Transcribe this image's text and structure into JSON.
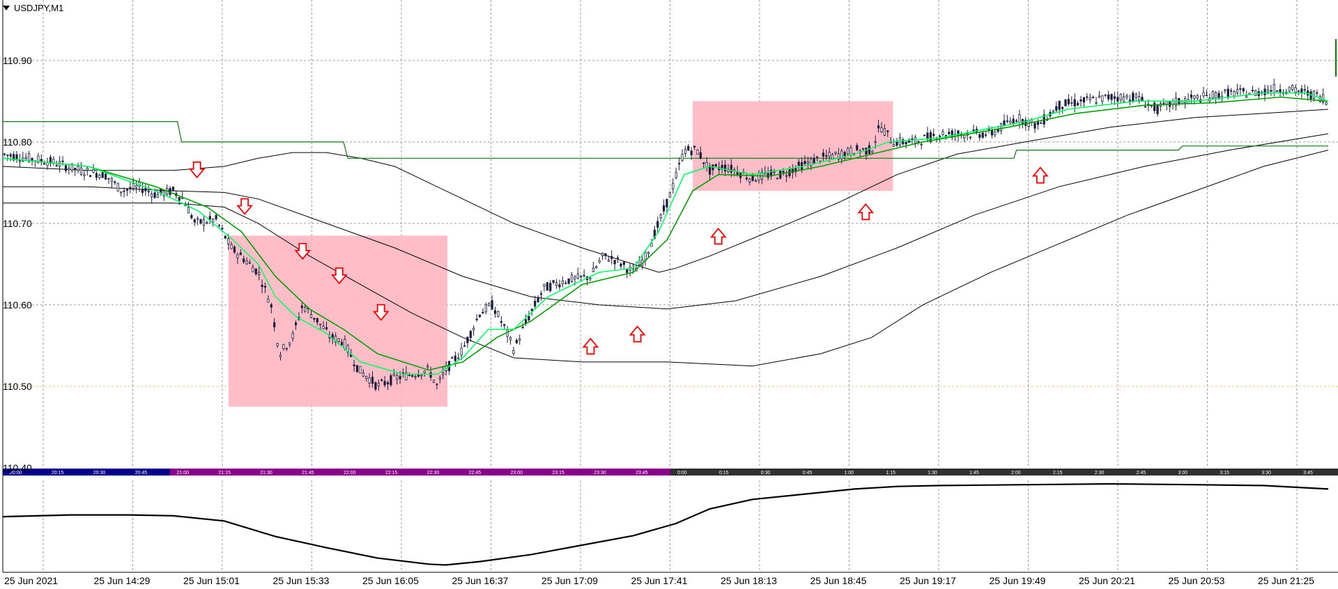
{
  "chart_window": {
    "title": "USDJPY,M1",
    "menu_icon": "triangle-down-icon"
  },
  "colors": {
    "candle": "#1a1a3e",
    "ema_fast": "#00ff66",
    "ema_slow": "#00a000",
    "ma": "#000000",
    "level": "#0a7a0a",
    "zone": "#ffb6c1",
    "arrow": "#ff0000",
    "grid": "#9a9a9a",
    "price_line": "#f0c060",
    "session_asia": "#8b008b",
    "session_ny": "#00008b",
    "session_other": "#303030"
  },
  "y_axis_labels": [
    "110.90",
    "110.80",
    "110.70",
    "110.60",
    "110.50",
    "110.40"
  ],
  "x_axis_labels": [
    "25 Jun 2021",
    "25 Jun 14:29",
    "25 Jun 15:01",
    "25 Jun 15:33",
    "25 Jun 16:05",
    "25 Jun 16:37",
    "25 Jun 17:09",
    "25 Jun 17:41",
    "25 Jun 18:13",
    "25 Jun 18:45",
    "25 Jun 19:17",
    "25 Jun 19:49",
    "25 Jun 20:21",
    "25 Jun 20:53",
    "25 Jun 21:25"
  ],
  "session_strip": {
    "labels": [
      "20:00",
      "20:15",
      "20:30",
      "20:45",
      "21:00",
      "21:15",
      "21:30",
      "21:45",
      "22:00",
      "22:15",
      "22:30",
      "22:45",
      "23:00",
      "23:15",
      "23:30",
      "23:45",
      "0:00",
      "0:15",
      "0:30",
      "0:45",
      "1:00",
      "1:15",
      "1:30",
      "1:45",
      "2:00",
      "2:15",
      "2:30",
      "2:45",
      "3:00",
      "3:15",
      "3:30",
      "3:45"
    ]
  },
  "chart_data": {
    "type": "candlestick",
    "symbol": "USDJPY",
    "timeframe": "M1",
    "ylim": [
      110.4,
      110.94
    ],
    "grid": true,
    "current_price_line": 110.5,
    "price_path": [
      [
        0,
        110.785
      ],
      [
        30,
        110.78
      ],
      [
        60,
        110.775
      ],
      [
        90,
        110.765
      ],
      [
        120,
        110.76
      ],
      [
        140,
        110.74
      ],
      [
        160,
        110.745
      ],
      [
        180,
        110.735
      ],
      [
        200,
        110.74
      ],
      [
        212,
        110.73
      ],
      [
        226,
        110.7
      ],
      [
        250,
        110.705
      ],
      [
        268,
        110.67
      ],
      [
        285,
        110.655
      ],
      [
        300,
        110.64
      ],
      [
        315,
        110.6
      ],
      [
        325,
        110.54
      ],
      [
        340,
        110.56
      ],
      [
        352,
        110.6
      ],
      [
        370,
        110.58
      ],
      [
        385,
        110.56
      ],
      [
        400,
        110.555
      ],
      [
        418,
        110.52
      ],
      [
        430,
        110.51
      ],
      [
        440,
        110.5
      ],
      [
        460,
        110.51
      ],
      [
        480,
        110.515
      ],
      [
        500,
        110.52
      ],
      [
        510,
        110.5
      ],
      [
        520,
        110.52
      ],
      [
        540,
        110.545
      ],
      [
        560,
        110.59
      ],
      [
        575,
        110.6
      ],
      [
        590,
        110.57
      ],
      [
        600,
        110.545
      ],
      [
        615,
        110.58
      ],
      [
        635,
        110.62
      ],
      [
        660,
        110.63
      ],
      [
        690,
        110.635
      ],
      [
        705,
        110.66
      ],
      [
        720,
        110.655
      ],
      [
        740,
        110.64
      ],
      [
        755,
        110.66
      ],
      [
        770,
        110.7
      ],
      [
        785,
        110.74
      ],
      [
        800,
        110.79
      ],
      [
        815,
        110.79
      ],
      [
        830,
        110.765
      ],
      [
        845,
        110.77
      ],
      [
        860,
        110.765
      ],
      [
        880,
        110.755
      ],
      [
        900,
        110.76
      ],
      [
        915,
        110.76
      ],
      [
        935,
        110.77
      ],
      [
        960,
        110.78
      ],
      [
        985,
        110.785
      ],
      [
        1000,
        110.79
      ],
      [
        1020,
        110.79
      ],
      [
        1030,
        110.82
      ],
      [
        1045,
        110.8
      ],
      [
        1070,
        110.8
      ],
      [
        1100,
        110.81
      ],
      [
        1130,
        110.81
      ],
      [
        1160,
        110.81
      ],
      [
        1190,
        110.83
      ],
      [
        1215,
        110.82
      ],
      [
        1240,
        110.845
      ],
      [
        1270,
        110.85
      ],
      [
        1300,
        110.855
      ],
      [
        1330,
        110.855
      ],
      [
        1355,
        110.84
      ],
      [
        1380,
        110.85
      ],
      [
        1410,
        110.855
      ],
      [
        1440,
        110.86
      ],
      [
        1470,
        110.86
      ],
      [
        1490,
        110.865
      ],
      [
        1510,
        110.865
      ],
      [
        1530,
        110.86
      ],
      [
        1550,
        110.855
      ],
      [
        1556,
        110.845
      ]
    ],
    "ema_fast_path": [
      [
        0,
        110.78
      ],
      [
        100,
        110.77
      ],
      [
        180,
        110.74
      ],
      [
        230,
        110.715
      ],
      [
        270,
        110.68
      ],
      [
        300,
        110.65
      ],
      [
        320,
        110.61
      ],
      [
        345,
        110.585
      ],
      [
        380,
        110.565
      ],
      [
        420,
        110.53
      ],
      [
        470,
        110.515
      ],
      [
        510,
        110.515
      ],
      [
        540,
        110.535
      ],
      [
        570,
        110.57
      ],
      [
        600,
        110.57
      ],
      [
        640,
        110.61
      ],
      [
        700,
        110.64
      ],
      [
        740,
        110.645
      ],
      [
        770,
        110.69
      ],
      [
        800,
        110.76
      ],
      [
        830,
        110.77
      ],
      [
        880,
        110.76
      ],
      [
        940,
        110.77
      ],
      [
        1000,
        110.785
      ],
      [
        1040,
        110.8
      ],
      [
        1100,
        110.805
      ],
      [
        1200,
        110.825
      ],
      [
        1250,
        110.84
      ],
      [
        1330,
        110.85
      ],
      [
        1400,
        110.85
      ],
      [
        1480,
        110.86
      ],
      [
        1530,
        110.86
      ],
      [
        1556,
        110.85
      ]
    ],
    "ema_slow_path": [
      [
        0,
        110.78
      ],
      [
        100,
        110.77
      ],
      [
        180,
        110.745
      ],
      [
        240,
        110.72
      ],
      [
        280,
        110.69
      ],
      [
        320,
        110.635
      ],
      [
        360,
        110.595
      ],
      [
        400,
        110.57
      ],
      [
        440,
        110.54
      ],
      [
        500,
        110.52
      ],
      [
        540,
        110.53
      ],
      [
        580,
        110.56
      ],
      [
        620,
        110.58
      ],
      [
        680,
        110.625
      ],
      [
        740,
        110.64
      ],
      [
        780,
        110.68
      ],
      [
        810,
        110.74
      ],
      [
        840,
        110.76
      ],
      [
        900,
        110.758
      ],
      [
        960,
        110.77
      ],
      [
        1020,
        110.785
      ],
      [
        1080,
        110.8
      ],
      [
        1180,
        110.818
      ],
      [
        1260,
        110.835
      ],
      [
        1340,
        110.845
      ],
      [
        1420,
        110.848
      ],
      [
        1500,
        110.855
      ],
      [
        1556,
        110.85
      ]
    ],
    "ma_paths": [
      [
        [
          0,
          110.77
        ],
        [
          100,
          110.765
        ],
        [
          200,
          110.765
        ],
        [
          260,
          110.77
        ],
        [
          300,
          110.78
        ],
        [
          340,
          110.787
        ],
        [
          380,
          110.787
        ],
        [
          420,
          110.78
        ],
        [
          460,
          110.77
        ],
        [
          520,
          110.74
        ],
        [
          600,
          110.7
        ],
        [
          680,
          110.67
        ],
        [
          740,
          110.65
        ],
        [
          770,
          110.64
        ],
        [
          790,
          110.645
        ],
        [
          830,
          110.66
        ],
        [
          900,
          110.69
        ],
        [
          980,
          110.725
        ],
        [
          1050,
          110.76
        ],
        [
          1120,
          110.785
        ],
        [
          1200,
          110.8
        ],
        [
          1300,
          110.818
        ],
        [
          1400,
          110.83
        ],
        [
          1480,
          110.835
        ],
        [
          1556,
          110.84
        ]
      ],
      [
        [
          0,
          110.745
        ],
        [
          100,
          110.745
        ],
        [
          200,
          110.74
        ],
        [
          260,
          110.738
        ],
        [
          300,
          110.73
        ],
        [
          380,
          110.7
        ],
        [
          460,
          110.67
        ],
        [
          540,
          110.635
        ],
        [
          620,
          110.61
        ],
        [
          700,
          110.6
        ],
        [
          780,
          110.595
        ],
        [
          860,
          110.605
        ],
        [
          960,
          110.635
        ],
        [
          1050,
          110.67
        ],
        [
          1140,
          110.71
        ],
        [
          1240,
          110.745
        ],
        [
          1340,
          110.77
        ],
        [
          1440,
          110.79
        ],
        [
          1556,
          110.81
        ]
      ],
      [
        [
          0,
          110.725
        ],
        [
          100,
          110.725
        ],
        [
          200,
          110.725
        ],
        [
          260,
          110.72
        ],
        [
          300,
          110.7
        ],
        [
          360,
          110.66
        ],
        [
          420,
          110.625
        ],
        [
          480,
          110.59
        ],
        [
          540,
          110.56
        ],
        [
          600,
          110.535
        ],
        [
          680,
          110.53
        ],
        [
          780,
          110.53
        ],
        [
          880,
          110.525
        ],
        [
          960,
          110.54
        ],
        [
          1020,
          110.56
        ],
        [
          1080,
          110.6
        ],
        [
          1160,
          110.64
        ],
        [
          1240,
          110.675
        ],
        [
          1320,
          110.71
        ],
        [
          1400,
          110.74
        ],
        [
          1480,
          110.77
        ],
        [
          1556,
          110.79
        ]
      ]
    ],
    "level_steps": [
      [
        0,
        110.825
      ],
      [
        205,
        110.825
      ],
      [
        210,
        110.8
      ],
      [
        400,
        110.8
      ],
      [
        405,
        110.78
      ],
      [
        1187,
        110.78
      ],
      [
        1190,
        110.79
      ],
      [
        1380,
        110.79
      ],
      [
        1385,
        110.795
      ],
      [
        1556,
        110.795
      ]
    ],
    "zones": [
      {
        "x0": 265,
        "x1": 522,
        "p_top": 110.685,
        "p_bot": 110.475
      },
      {
        "x0": 810,
        "x1": 1045,
        "p_top": 110.85,
        "p_bot": 110.74
      }
    ],
    "arrows_down": [
      [
        228,
        110.765
      ],
      [
        284,
        110.72
      ],
      [
        352,
        110.665
      ],
      [
        395,
        110.635
      ],
      [
        444,
        110.59
      ]
    ],
    "arrows_up": [
      [
        690,
        110.55
      ],
      [
        745,
        110.565
      ],
      [
        840,
        110.685
      ],
      [
        1013,
        110.715
      ],
      [
        1218,
        110.76
      ]
    ],
    "oscillator_path": [
      [
        0,
        0.42
      ],
      [
        80,
        0.4
      ],
      [
        150,
        0.4
      ],
      [
        200,
        0.41
      ],
      [
        260,
        0.47
      ],
      [
        320,
        0.65
      ],
      [
        380,
        0.78
      ],
      [
        440,
        0.9
      ],
      [
        500,
        0.97
      ],
      [
        520,
        0.98
      ],
      [
        560,
        0.94
      ],
      [
        620,
        0.86
      ],
      [
        680,
        0.75
      ],
      [
        740,
        0.64
      ],
      [
        790,
        0.5
      ],
      [
        830,
        0.33
      ],
      [
        880,
        0.22
      ],
      [
        930,
        0.17
      ],
      [
        1000,
        0.1
      ],
      [
        1050,
        0.07
      ],
      [
        1100,
        0.06
      ],
      [
        1200,
        0.05
      ],
      [
        1300,
        0.04
      ],
      [
        1400,
        0.05
      ],
      [
        1480,
        0.06
      ],
      [
        1556,
        0.1
      ]
    ]
  }
}
